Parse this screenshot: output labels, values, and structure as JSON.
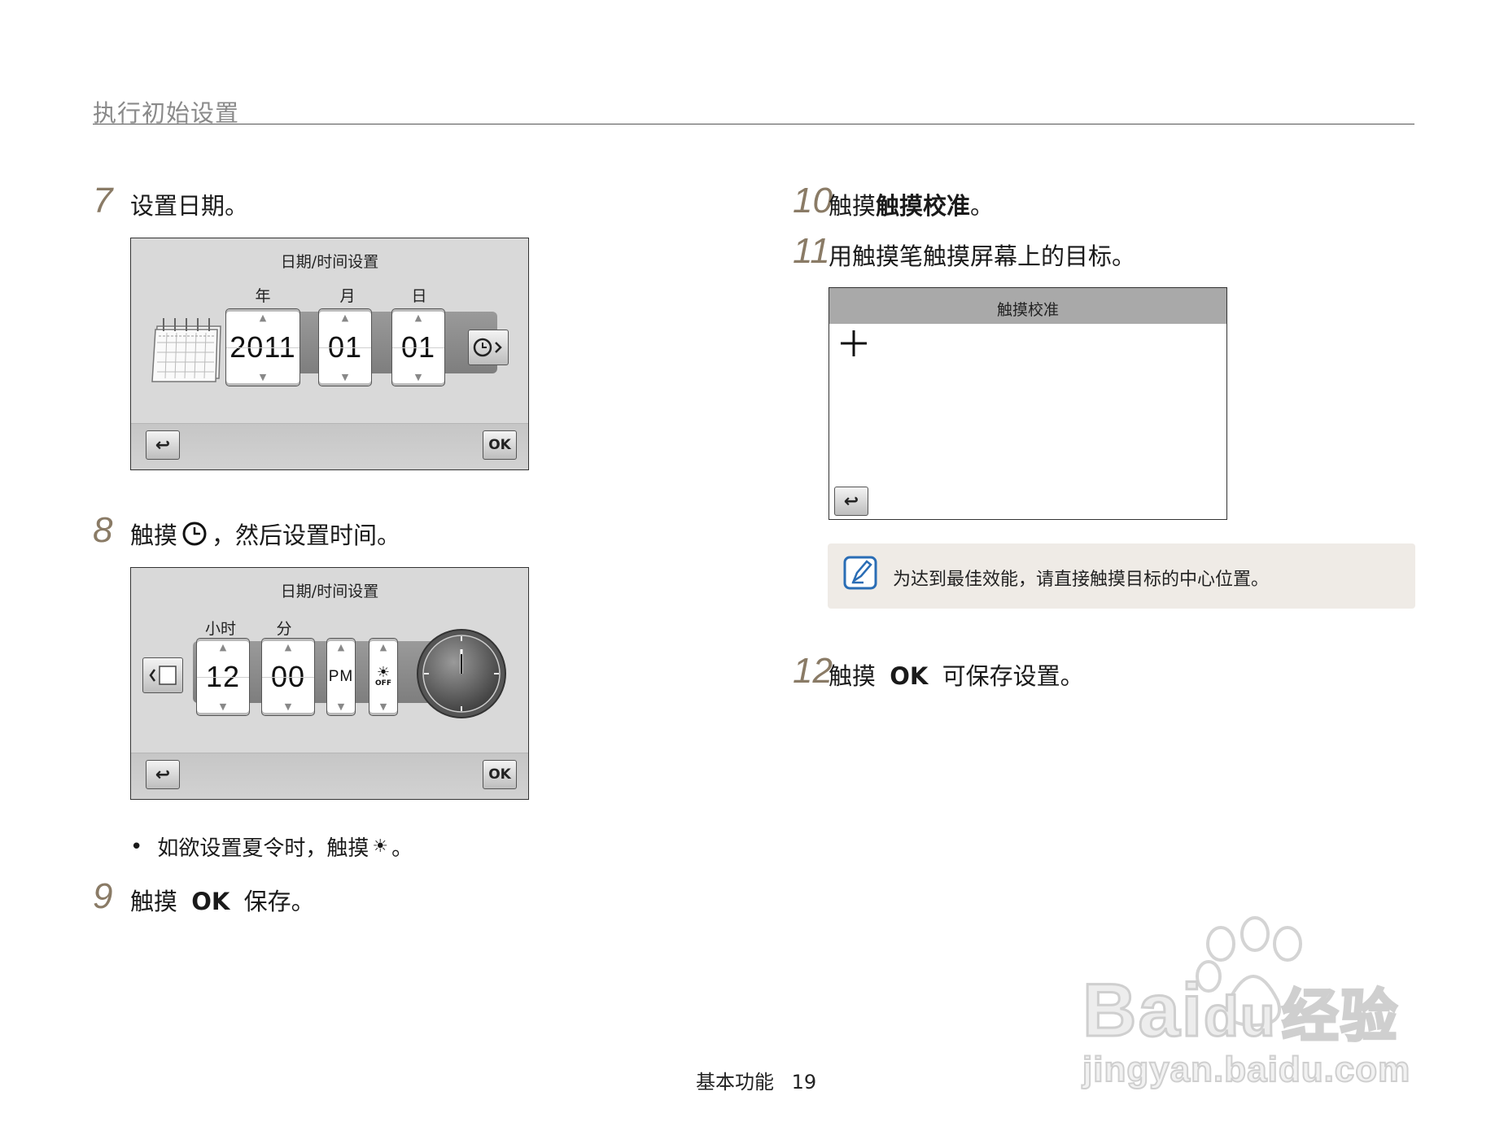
{
  "header": {
    "title": "执行初始设置"
  },
  "steps": {
    "s7": {
      "num": "7",
      "text": "设置日期。"
    },
    "s8": {
      "num": "8",
      "text_before": "触摸",
      "text_after": "，然后设置时间。"
    },
    "s8_bullet": {
      "text_before": "如欲设置夏令时，触摸",
      "text_after": "。"
    },
    "s9": {
      "num": "9",
      "text_before": "触摸",
      "ok": "OK",
      "text_after": "保存。"
    },
    "s10": {
      "num": "10",
      "text_before": "触摸",
      "bold": "触摸校准",
      "text_after": "。"
    },
    "s11": {
      "num": "11",
      "text": "用触摸笔触摸屏幕上的目标。"
    },
    "s12": {
      "num": "12",
      "text_before": "触摸",
      "ok": "OK",
      "text_after": "可保存设置。"
    }
  },
  "date_screen": {
    "title": "日期/时间设置",
    "labels": {
      "year": "年",
      "month": "月",
      "day": "日"
    },
    "values": {
      "year": "2011",
      "month": "01",
      "day": "01"
    },
    "ok": "OK"
  },
  "time_screen": {
    "title": "日期/时间设置",
    "labels": {
      "hour": "小时",
      "minute": "分"
    },
    "values": {
      "hour": "12",
      "minute": "00",
      "ampm": "PM",
      "dst": "OFF"
    },
    "ok": "OK"
  },
  "calib_screen": {
    "title": "触摸校准"
  },
  "note": {
    "text": "为达到最佳效能，请直接触摸目标的中心位置。"
  },
  "footer": {
    "section": "基本功能",
    "page": "19"
  },
  "watermark": {
    "brand_a": "Bai",
    "brand_b": "du",
    "brand_c": "经验",
    "url": "jingyan.baidu.com"
  }
}
